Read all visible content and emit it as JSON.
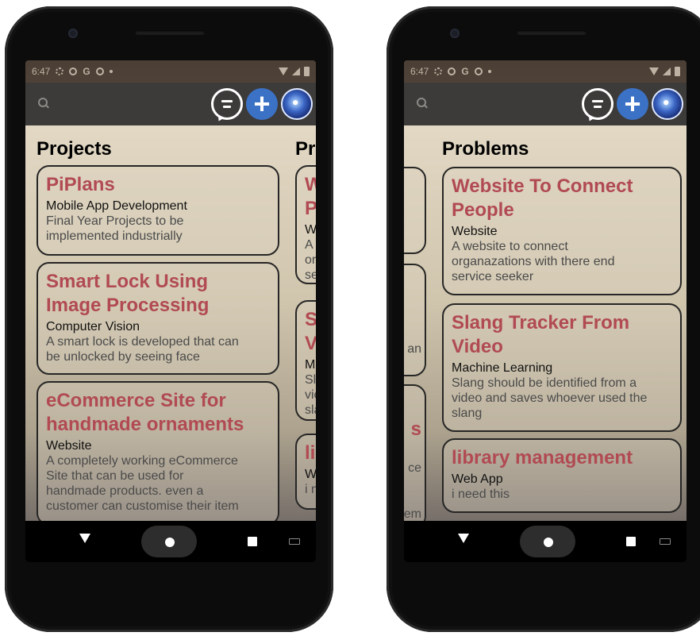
{
  "status_bar": {
    "time": "6:47",
    "letter": "G"
  },
  "left_screen": {
    "section_title": "Projects",
    "next_section_peek": "Pr",
    "cards": [
      {
        "title_lines": [
          "PiPlans"
        ],
        "category": "Mobile App Development",
        "desc_lines": [
          "Final Year Projects to be",
          "implemented industrially"
        ]
      },
      {
        "title_lines": [
          "Smart Lock Using",
          "Image Processing"
        ],
        "category": "Computer Vision",
        "desc_lines": [
          "A smart lock is developed that can",
          "be unlocked by seeing face"
        ]
      },
      {
        "title_lines": [
          "eCommerce Site for",
          "handmade ornaments"
        ],
        "category": "Website",
        "desc_lines": [
          "A completely working eCommerce",
          "Site that can be used for",
          "handmade products. even a",
          "customer can customise their item"
        ]
      }
    ],
    "peek_cards": [
      {
        "title_lines": [
          "W",
          "Pe"
        ],
        "category": "We",
        "desc_lines": [
          "A w",
          "org",
          "se"
        ]
      },
      {
        "title_lines": [
          "Sl",
          "Vi"
        ],
        "category": "Ma",
        "desc_lines": [
          "Sla",
          "vic",
          "sla"
        ]
      },
      {
        "title_lines": [
          "lil"
        ],
        "category": "We",
        "desc_lines": [
          "i n"
        ]
      }
    ]
  },
  "right_screen": {
    "section_title": "Problems",
    "cards": [
      {
        "title_lines": [
          "Website To Connect",
          "People"
        ],
        "category": "Website",
        "desc_lines": [
          "A website to connect",
          "organazations with there end",
          "service seeker"
        ]
      },
      {
        "title_lines": [
          "Slang Tracker From",
          "Video"
        ],
        "category": "Machine Learning",
        "desc_lines": [
          "Slang should be identified from a",
          "video and saves whoever used the",
          "slang"
        ]
      },
      {
        "title_lines": [
          "library management"
        ],
        "category": "Web App",
        "desc_lines": [
          "i need this"
        ]
      }
    ],
    "prev_peek_texts": [
      "an",
      "s",
      "ce",
      "em"
    ]
  },
  "colors": {
    "card_title": "#b14a52",
    "add_button": "#3b72c6",
    "app_bar": "#3d3b39"
  },
  "icons": {
    "search": "search-icon",
    "chat": "chat-icon",
    "add": "plus-icon",
    "avatar": "avatar",
    "nav_back": "triangle-back-icon",
    "nav_home": "circle-home-icon",
    "nav_recents": "square-recents-icon"
  }
}
